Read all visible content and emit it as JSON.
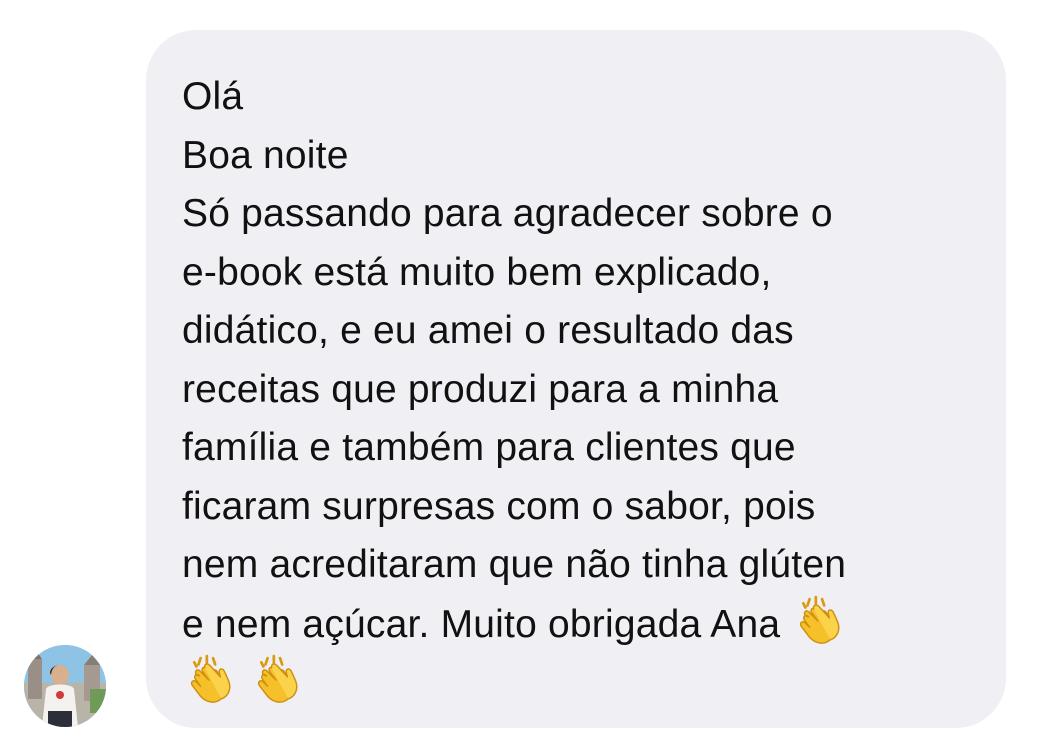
{
  "message": {
    "lines": [
      "Olá",
      "Boa noite",
      "Só passando para agradecer sobre o",
      "e-book está muito bem explicado,",
      "didático, e eu amei o resultado das",
      "receitas que produzi para a minha",
      "família e  também para clientes que",
      "ficaram surpresas com o sabor, pois",
      "nem acreditaram que não tinha glúten",
      "e nem açúcar. Muito obrigada Ana"
    ],
    "trailing_icons": [
      "clapping-hands-icon",
      "clapping-hands-icon",
      "clapping-hands-icon"
    ]
  },
  "sender": {
    "avatar_icon": "avatar"
  },
  "colors": {
    "bubble_background": "#f0f0f4",
    "text": "#111111",
    "emoji_yellow": "#f5c02a"
  }
}
